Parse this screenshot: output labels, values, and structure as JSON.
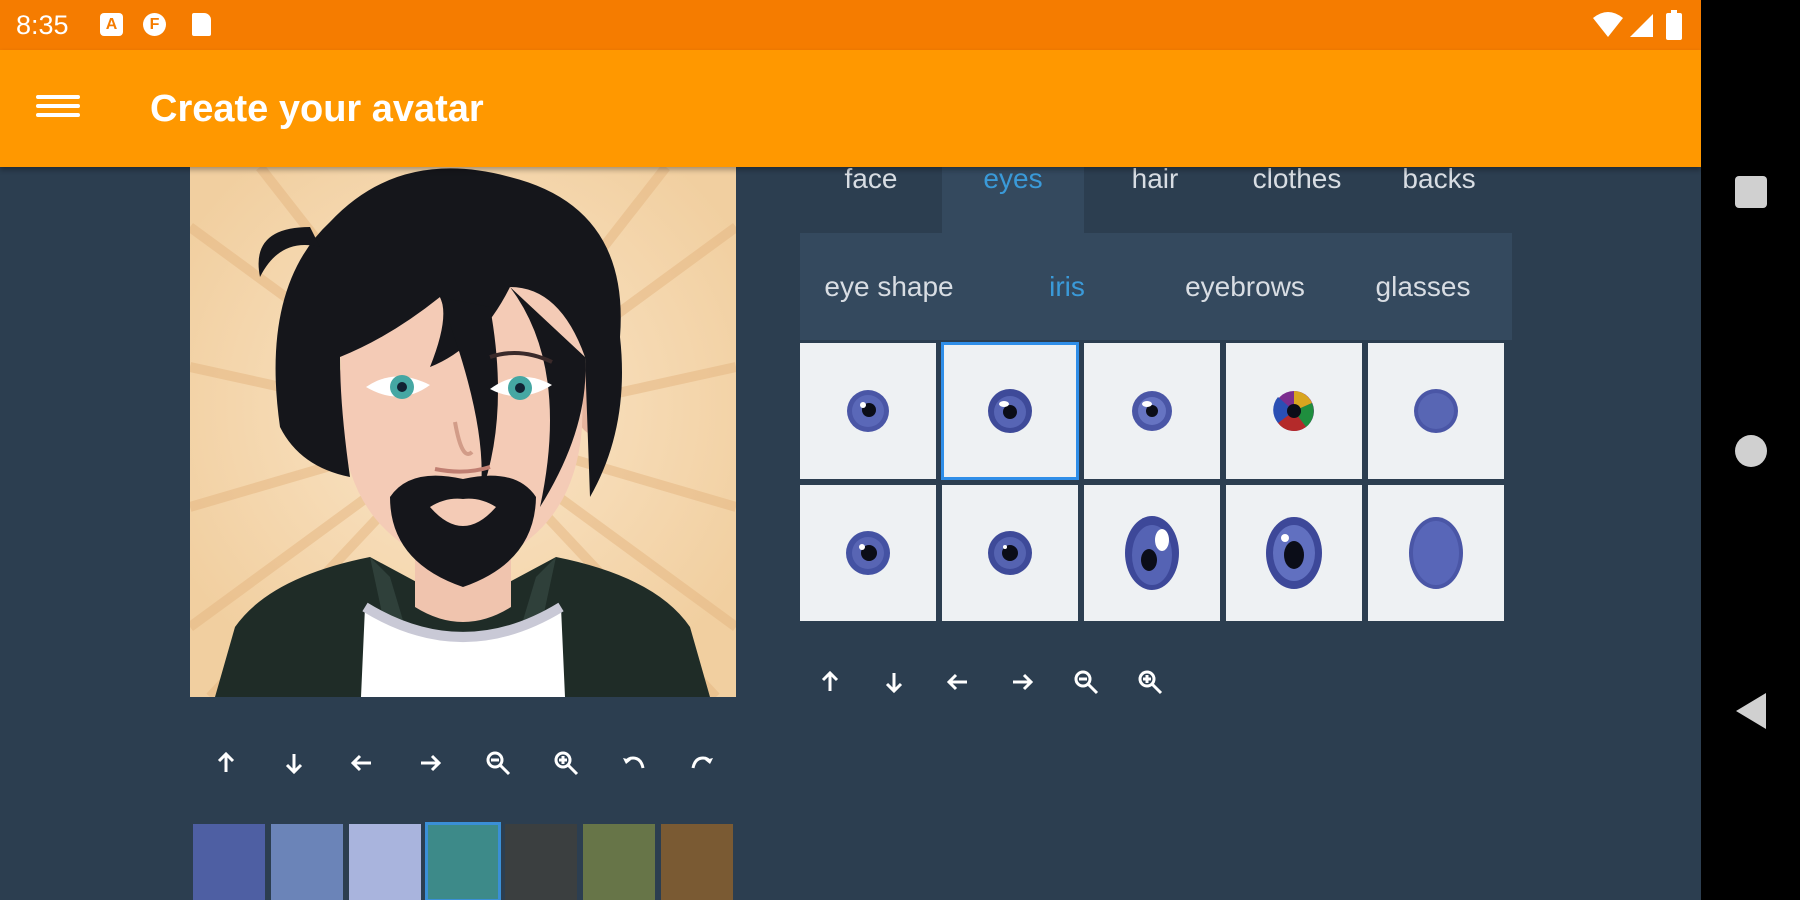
{
  "status_bar": {
    "time": "8:35",
    "notification_icons": [
      "a-icon",
      "f-icon",
      "sd-card-icon"
    ],
    "system_icons": [
      "wifi-icon",
      "signal-icon",
      "battery-icon"
    ]
  },
  "app_bar": {
    "menu_icon": "hamburger-menu-icon",
    "title": "Create your avatar"
  },
  "category_tabs": [
    {
      "label": "face",
      "active": false
    },
    {
      "label": "eyes",
      "active": true
    },
    {
      "label": "hair",
      "active": false
    },
    {
      "label": "clothes",
      "active": false
    },
    {
      "label": "backs",
      "active": false
    }
  ],
  "sub_tabs": [
    {
      "label": "eye shape",
      "active": false
    },
    {
      "label": "iris",
      "active": true
    },
    {
      "label": "eyebrows",
      "active": false
    },
    {
      "label": "glasses",
      "active": false
    }
  ],
  "iris_options": [
    {
      "style": "round",
      "selected": false
    },
    {
      "style": "round-highlight",
      "selected": true
    },
    {
      "style": "round-small",
      "selected": false
    },
    {
      "style": "multicolor",
      "selected": false
    },
    {
      "style": "solid",
      "selected": false
    },
    {
      "style": "round",
      "selected": false
    },
    {
      "style": "round-dark",
      "selected": false
    },
    {
      "style": "oval-highlight",
      "selected": false
    },
    {
      "style": "oval-pupil",
      "selected": false
    },
    {
      "style": "oval-solid",
      "selected": false
    }
  ],
  "iris_tools": [
    "arrow-up-icon",
    "arrow-down-icon",
    "arrow-left-icon",
    "arrow-right-icon",
    "zoom-out-icon",
    "zoom-in-icon"
  ],
  "preview_tools": [
    "arrow-up-icon",
    "arrow-down-icon",
    "arrow-left-icon",
    "arrow-right-icon",
    "zoom-out-icon",
    "zoom-in-icon",
    "rotate-left-icon",
    "rotate-right-icon"
  ],
  "color_swatches": [
    {
      "color": "#4e5fa3",
      "selected": false
    },
    {
      "color": "#6b84b8",
      "selected": false
    },
    {
      "color": "#a9b4dd",
      "selected": false
    },
    {
      "color": "#3d8a89",
      "selected": true
    },
    {
      "color": "#3b3f40",
      "selected": false
    },
    {
      "color": "#677548",
      "selected": false
    },
    {
      "color": "#7a5a33",
      "selected": false
    }
  ],
  "colors": {
    "status_bar": "#f57c00",
    "app_bar": "#ff9800",
    "background": "#2c3e50",
    "panel": "#34495e",
    "accent": "#3a9ad9",
    "iris": "#4a56a6"
  }
}
